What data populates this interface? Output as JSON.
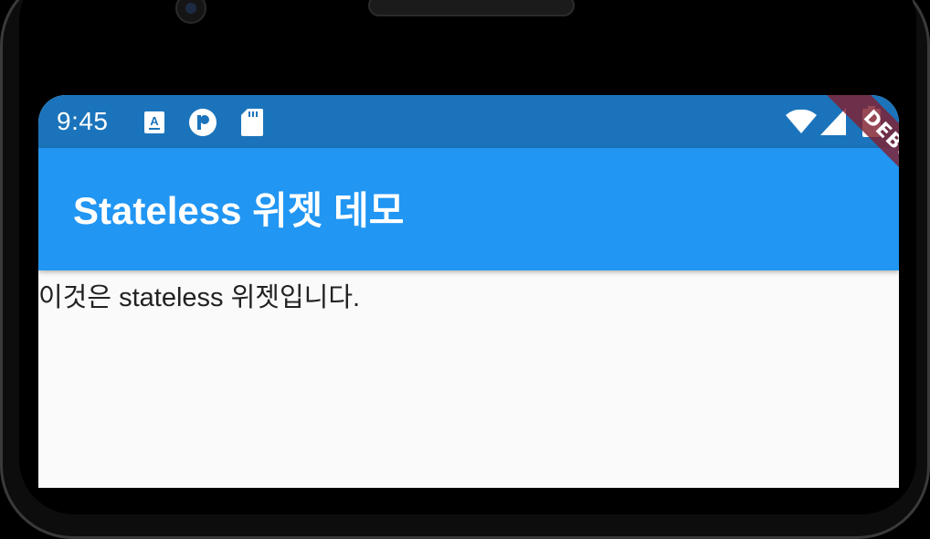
{
  "status_bar": {
    "time": "9:45",
    "icons": [
      "font-a-icon",
      "circle-p-icon",
      "sd-card-icon",
      "wifi-icon",
      "signal-icon",
      "battery-icon"
    ]
  },
  "app_bar": {
    "title": "Stateless 위젯 데모"
  },
  "body": {
    "text": "이것은 stateless 위젯입니다."
  },
  "debug_banner": {
    "label": "DEBUG"
  },
  "colors": {
    "status_bar": "#1b74bb",
    "app_bar": "#2196f3",
    "background": "#fafafa",
    "debug_banner": "#802030"
  }
}
